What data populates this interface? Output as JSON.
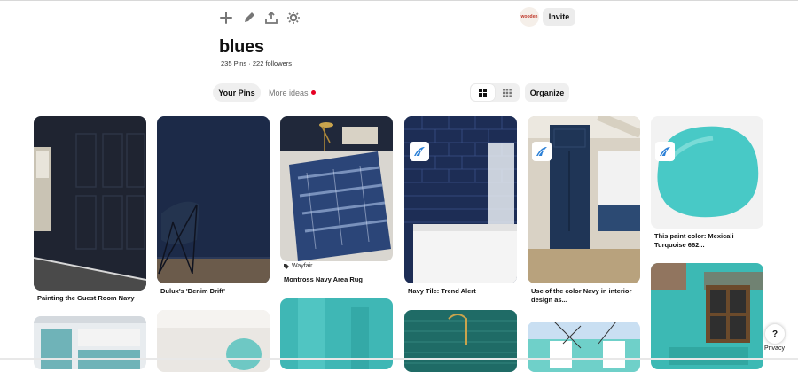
{
  "toolbar": {
    "add_icon": "plus-icon",
    "edit_icon": "pencil-icon",
    "share_icon": "share-icon",
    "settings_icon": "gear-icon"
  },
  "header": {
    "avatar_text": "wooden",
    "invite_label": "Invite"
  },
  "board": {
    "title": "blues",
    "meta": "235 Pins · 222 followers"
  },
  "tabs": {
    "your_pins": "Your Pins",
    "more_ideas": "More ideas"
  },
  "controls": {
    "organize_label": "Organize"
  },
  "pins": [
    {
      "caption": "Painting the Guest Room Navy"
    },
    {
      "caption": "Dulux's 'Denim Drift'"
    },
    {
      "source": "Wayfair",
      "caption": "Montross Navy Area Rug"
    },
    {
      "caption": "Navy Tile: Trend Alert"
    },
    {
      "caption": "Use of the color Navy in interior design as..."
    },
    {
      "caption": "This paint color: Mexicali Turquoise 662..."
    }
  ],
  "footer": {
    "help_label": "?",
    "privacy_label": "Privacy"
  },
  "colors": {
    "accent_red": "#e60023",
    "navy": "#1c2a48",
    "turquoise": "#48c9c6"
  }
}
